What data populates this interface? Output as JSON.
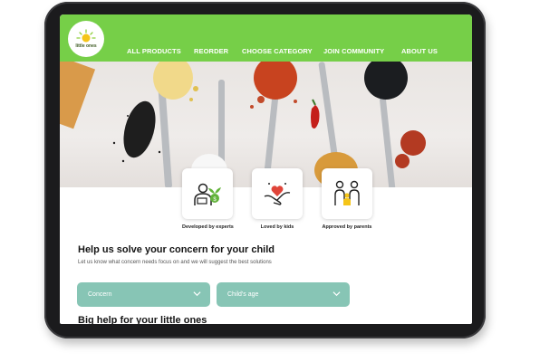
{
  "brand": {
    "logo_text": "little ones"
  },
  "nav": {
    "items": [
      "ALL PRODUCTS",
      "REORDER",
      "CHOOSE CATEGORY",
      "JOIN COMMUNITY",
      "ABOUT US"
    ]
  },
  "features": [
    {
      "label": "Developed by experts",
      "icon": "expert-with-plant-icon"
    },
    {
      "label": "Loved by kids",
      "icon": "heart-in-hands-icon"
    },
    {
      "label": "Approved by parents",
      "icon": "family-icon"
    }
  ],
  "concern_section": {
    "title": "Help us solve your concern for your child",
    "subtitle": "Let us know what concern needs focus on and we will suggest the best solutions",
    "concern_select": "Concern",
    "age_select": "Child's age"
  },
  "next_section": {
    "title": "Big help for your little ones"
  },
  "colors": {
    "nav_green": "#76cf48",
    "select_teal": "#87c5b5",
    "device_frame": "#1b1b1d"
  }
}
